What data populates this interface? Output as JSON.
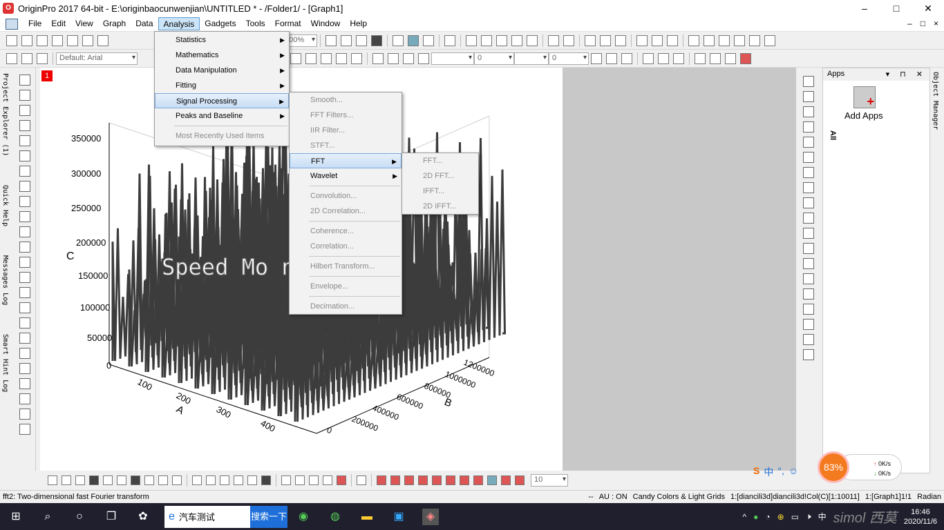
{
  "window": {
    "title": "OriginPro 2017 64-bit - E:\\originbaocunwenjian\\UNTITLED * - /Folder1/ - [Graph1]",
    "controls": [
      "–",
      "□",
      "✕"
    ]
  },
  "menubar": {
    "items": [
      "File",
      "Edit",
      "View",
      "Graph",
      "Data",
      "Analysis",
      "Gadgets",
      "Tools",
      "Format",
      "Window",
      "Help"
    ],
    "right_controls": [
      "–",
      "□",
      "×"
    ]
  },
  "toolbar": {
    "zoom": "100%",
    "font": "Default: Arial",
    "line_width": "0",
    "fill_value": "0"
  },
  "left_tabs": [
    "Project Explorer (1)",
    "Quick Help",
    "Messages Log",
    "Smart Hint Log"
  ],
  "graph": {
    "layer_number": "1",
    "watermark": "Speed Mo         n",
    "z_axis_label": "C",
    "x_axis_label": "A",
    "y_axis_label": "B",
    "z_ticks": [
      "350000",
      "300000",
      "250000",
      "200000",
      "150000",
      "100000",
      "50000",
      "0"
    ],
    "x_ticks": [
      "100",
      "200",
      "300",
      "400"
    ],
    "y_ticks": [
      "1200000",
      "1000000",
      "800000",
      "600000",
      "400000",
      "200000",
      "0"
    ]
  },
  "apps_panel": {
    "title": "Apps",
    "tab": "All",
    "add_apps_label": "Add Apps",
    "object_manager": "Object Manager"
  },
  "menus": {
    "analysis": [
      {
        "label": "Statistics",
        "submenu": true
      },
      {
        "label": "Mathematics",
        "submenu": true
      },
      {
        "label": "Data Manipulation",
        "submenu": true
      },
      {
        "label": "Fitting",
        "submenu": true
      },
      {
        "label": "Signal Processing",
        "submenu": true,
        "highlighted": true
      },
      {
        "label": "Peaks and Baseline",
        "submenu": true
      },
      {
        "label": "Most Recently Used Items",
        "disabled": true
      }
    ],
    "signal_processing": [
      {
        "label": "Smooth...",
        "disabled": true
      },
      {
        "label": "FFT Filters...",
        "disabled": true
      },
      {
        "label": "IIR Filter...",
        "disabled": true
      },
      {
        "label": "STFT...",
        "disabled": true
      },
      {
        "label": "FFT",
        "submenu": true,
        "highlighted": true
      },
      {
        "label": "Wavelet",
        "submenu": true
      },
      {
        "label": "Convolution...",
        "disabled": true
      },
      {
        "label": "2D Correlation...",
        "disabled": true
      },
      {
        "label": "Coherence...",
        "disabled": true
      },
      {
        "label": "Correlation...",
        "disabled": true
      },
      {
        "label": "Hilbert Transform...",
        "disabled": true
      },
      {
        "label": "Envelope...",
        "disabled": true
      },
      {
        "label": "Decimation...",
        "disabled": true
      }
    ],
    "fft": [
      {
        "label": "FFT...",
        "disabled": true
      },
      {
        "label": "2D FFT...",
        "disabled": true
      },
      {
        "label": "IFFT...",
        "disabled": true
      },
      {
        "label": "2D IFFT...",
        "disabled": true
      }
    ]
  },
  "bottom_toolbar": {
    "size_value": "10"
  },
  "statusbar": {
    "hint": "fft2: Two-dimensional fast Fourier transform",
    "dashes": "--",
    "au": "AU : ON",
    "theme": "Candy Colors & Light Grids",
    "dataset": "1:[diancili3d]diancili3d!Col(C)[1:10011]",
    "graph_ref": "1:[Graph1]1!1",
    "angle_unit": "Radian"
  },
  "speed_widget": {
    "percent": "83%",
    "up": "0K/s",
    "down": "0K/s"
  },
  "ime": {
    "mode": "中",
    "punct": "°,"
  },
  "taskbar": {
    "search_text": "汽车测试",
    "search_button": "搜索一下",
    "time": "16:46",
    "date": "2020/11/6",
    "tray_lang": "中",
    "watermark": "simol 西莫"
  }
}
